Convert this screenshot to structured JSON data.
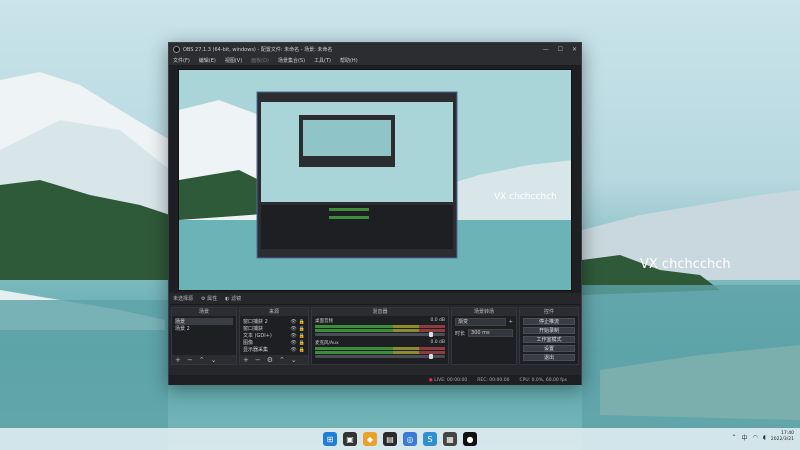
{
  "window": {
    "title": "OBS 27.1.3 (64-bit, windows) - 配置文件: 未命名 - 场景: 未命名",
    "minimize": "—",
    "maximize": "☐",
    "close": "✕"
  },
  "menu": [
    "文件(F)",
    "编辑(E)",
    "视图(V)",
    "面板(D)",
    "场景集合(S)",
    "工具(T)",
    "帮助(H)"
  ],
  "watermarks": [
    "VX chchcchch",
    "VX chchcchch"
  ],
  "scene_strip": {
    "label": "未选择源",
    "properties": "属性",
    "filters": "滤镜"
  },
  "docks": {
    "scenes": {
      "header": "场景",
      "items": [
        "场景",
        "场景 2"
      ]
    },
    "sources": {
      "header": "来源",
      "items": [
        "窗口捕获 2",
        "窗口捕获",
        "文本 (GDI+)",
        "图像",
        "显示器采集"
      ]
    },
    "mixer": {
      "header": "混音器",
      "channels": [
        {
          "name": "桌面音频",
          "level": "0.0 dB"
        },
        {
          "name": "麦克风/Aux",
          "level": "0.0 dB"
        }
      ]
    },
    "transitions": {
      "header": "场景转场",
      "type": "渐变",
      "duration_label": "时长",
      "duration_value": "300 ms"
    },
    "controls": {
      "header": "控件",
      "buttons": [
        "停止推流",
        "开始录制",
        "工作室模式",
        "设置",
        "退出"
      ]
    }
  },
  "status": {
    "live_dot": "●",
    "live": "LIVE: 00:00:00",
    "rec": "REC: 00:00:00",
    "cpu": "CPU: 0.0%, 60.00 fps"
  },
  "taskbar": {
    "time": "17:40",
    "date": "2022/3/21",
    "lang": "中"
  },
  "colors": {
    "accent": "#2b2d31",
    "window_bg": "#1e1f22"
  }
}
